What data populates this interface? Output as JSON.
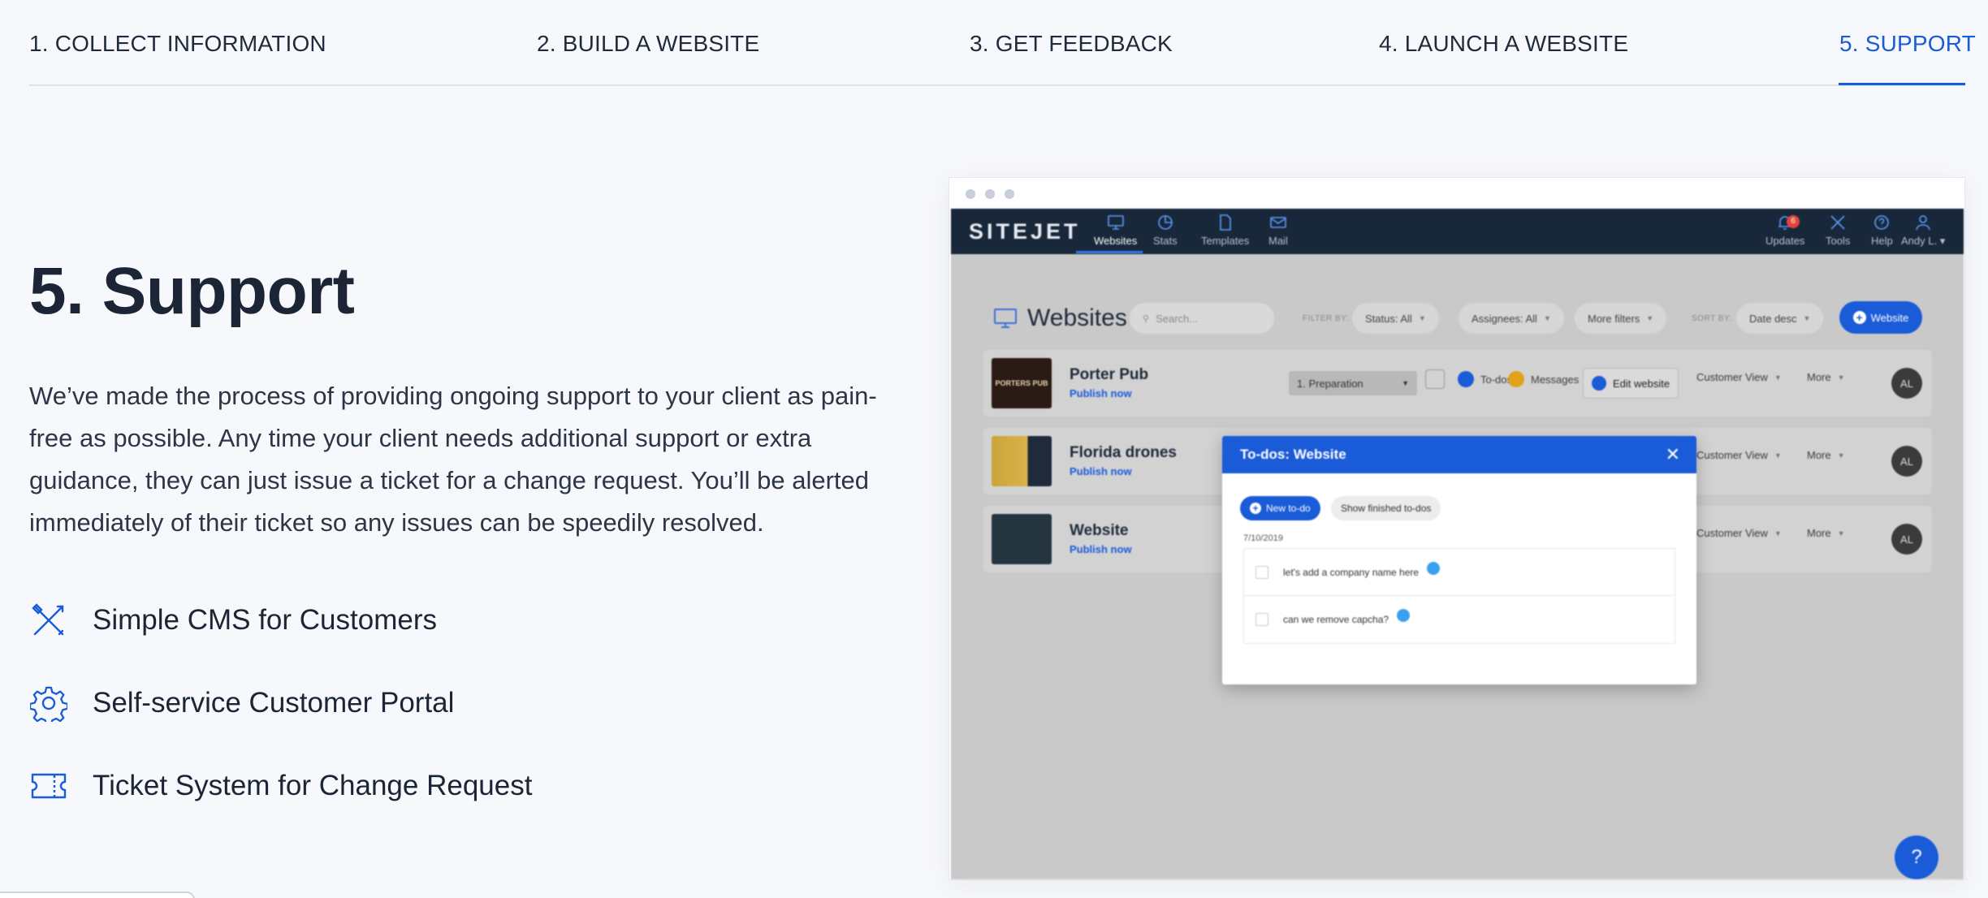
{
  "tabs": [
    {
      "label": "1. COLLECT INFORMATION"
    },
    {
      "label": "2. BUILD A WEBSITE"
    },
    {
      "label": "3. GET FEEDBACK"
    },
    {
      "label": "4. LAUNCH A WEBSITE"
    },
    {
      "label": "5. SUPPORT"
    }
  ],
  "active_tab_index": 4,
  "section": {
    "title": "5. Support",
    "description": "We’ve made the process of providing ongoing support to your client as pain-free as possible. Any time your client needs additional support or extra guidance, they can just issue a ticket for a change request. You’ll be alerted immediately of their ticket so any issues can be speedily resolved.",
    "features": [
      {
        "label": "Simple CMS for Customers",
        "icon": "tools-icon"
      },
      {
        "label": "Self-service Customer Portal",
        "icon": "gear-icon"
      },
      {
        "label": "Ticket System for Change Request",
        "icon": "ticket-icon"
      }
    ]
  },
  "preview": {
    "logo": "SITEJET",
    "nav": [
      {
        "label": "Websites",
        "icon": "monitor-icon"
      },
      {
        "label": "Stats",
        "icon": "pie-chart-icon"
      },
      {
        "label": "Templates",
        "icon": "document-icon"
      },
      {
        "label": "Mail",
        "icon": "mail-icon"
      }
    ],
    "nav_right": [
      {
        "label": "Updates",
        "icon": "bell-icon",
        "badge": "6"
      },
      {
        "label": "Tools",
        "icon": "tools-icon"
      },
      {
        "label": "Help",
        "icon": "help-icon"
      },
      {
        "label": "Andy L. ▾",
        "icon": "user-icon"
      }
    ],
    "content_title": "Websites",
    "search_placeholder": "Search...",
    "filter_by_label": "FILTER BY:",
    "filters": [
      "Status: All",
      "Assignees: All",
      "More filters"
    ],
    "sort_by_label": "SORT BY:",
    "sort_value": "Date desc",
    "add_button": "Website",
    "rows": [
      {
        "name": "Porter Pub",
        "action": "Publish now",
        "thumb": "PORTERS PUB"
      },
      {
        "name": "Florida drones",
        "action": "Publish now"
      },
      {
        "name": "Website",
        "action": "Publish now"
      }
    ],
    "row_controls": {
      "stage": "1. Preparation",
      "todos": "To-dos",
      "messages": "Messages",
      "edit": "Edit website",
      "customer_view": "Customer View",
      "more": "More",
      "avatar": "AL"
    },
    "modal": {
      "title": "To-dos: Website",
      "new_todo": "New to-do",
      "show_finished": "Show finished to-dos",
      "date": "7/10/2019",
      "todos": [
        "let's add a company name here",
        "can we remove capcha?"
      ]
    },
    "help_button": "?"
  },
  "colors": {
    "accent": "#1a5bd8",
    "nav_bg": "#19273a",
    "page_bg": "#f7f8fc"
  }
}
